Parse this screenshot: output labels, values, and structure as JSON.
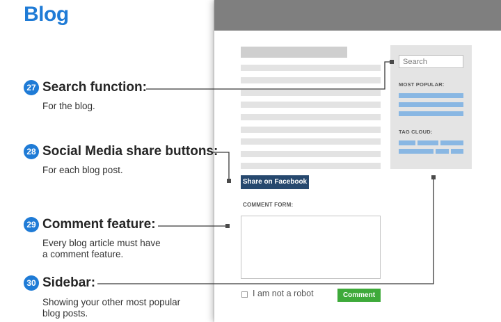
{
  "page": {
    "title": "Blog"
  },
  "callouts": [
    {
      "number": "27",
      "title": "Search function:",
      "description": [
        "For the blog."
      ]
    },
    {
      "number": "28",
      "title": "Social Media share buttons:",
      "description": [
        "For each blog post."
      ]
    },
    {
      "number": "29",
      "title": "Comment feature:",
      "description": [
        "Every blog article must have",
        "a comment feature."
      ]
    },
    {
      "number": "30",
      "title": "Sidebar:",
      "description": [
        "Showing your other most popular",
        "blog posts."
      ]
    }
  ],
  "mockup": {
    "share_button_label": "Share on Facebook",
    "comment_form_label": "COMMENT FORM:",
    "robot_check_label": "I am not a robot",
    "comment_button_label": "Comment",
    "sidebar": {
      "search_placeholder": "Search",
      "most_popular_label": "MOST POPULAR:",
      "tag_cloud_label": "TAG CLOUD:"
    }
  },
  "colors": {
    "accent_blue": "#1f7bd6",
    "facebook_button": "#26486e",
    "comment_button": "#3eaa3a",
    "link_blue": "#89b7e3"
  }
}
